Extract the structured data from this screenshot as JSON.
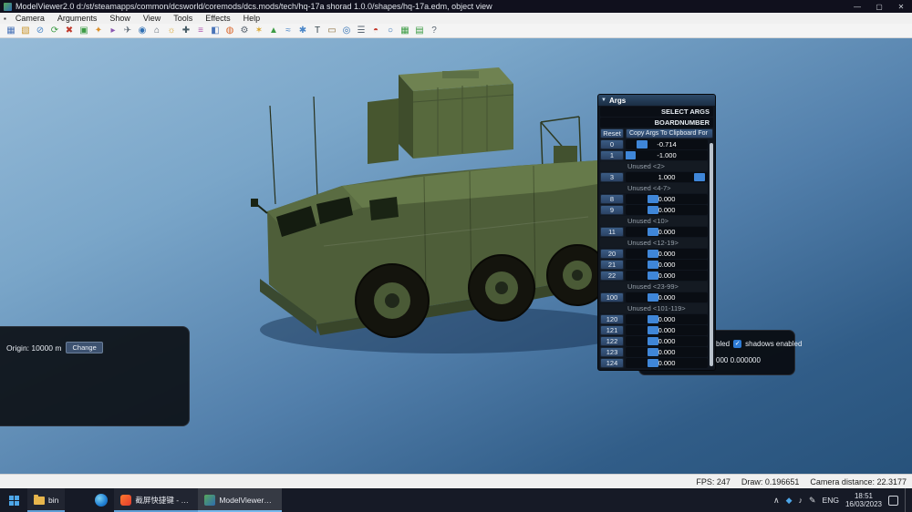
{
  "window": {
    "title": "ModelViewer2.0 d:/st/steamapps/common/dcsworld/coremods/dcs.mods/tech/hq-17a shorad 1.0.0/shapes/hq-17a.edm, object view",
    "controls": {
      "minimize": "—",
      "maximize": "▢",
      "close": "✕"
    }
  },
  "menu": {
    "icon_glyph": "▪",
    "items": [
      "Camera",
      "Arguments",
      "Show",
      "View",
      "Tools",
      "Effects",
      "Help"
    ]
  },
  "toolbar": {
    "icons": [
      {
        "name": "save",
        "glyph": "▦",
        "color": "#4a74b8"
      },
      {
        "name": "open",
        "glyph": "▧",
        "color": "#c9962f"
      },
      {
        "name": "block",
        "glyph": "⊘",
        "color": "#4a86c8"
      },
      {
        "name": "refresh",
        "glyph": "⟳",
        "color": "#3d9c45"
      },
      {
        "name": "clear",
        "glyph": "✖",
        "color": "#c0392b"
      },
      {
        "name": "package",
        "glyph": "▣",
        "color": "#3d9c45"
      },
      {
        "name": "star",
        "glyph": "✦",
        "color": "#d98f2b"
      },
      {
        "name": "pin",
        "glyph": "▸",
        "color": "#8a56b0"
      },
      {
        "name": "plane",
        "glyph": "✈",
        "color": "#5a6672"
      },
      {
        "name": "camera",
        "glyph": "◉",
        "color": "#2f6fb3"
      },
      {
        "name": "home",
        "glyph": "⌂",
        "color": "#5a6672"
      },
      {
        "name": "light",
        "glyph": "☼",
        "color": "#d9a42b"
      },
      {
        "name": "axes",
        "glyph": "✚",
        "color": "#455a64"
      },
      {
        "name": "chart",
        "glyph": "≡",
        "color": "#b05ab0"
      },
      {
        "name": "cube",
        "glyph": "◧",
        "color": "#4a74b8"
      },
      {
        "name": "paint",
        "glyph": "◍",
        "color": "#d9662b"
      },
      {
        "name": "gear",
        "glyph": "⚙",
        "color": "#5a6672"
      },
      {
        "name": "bulb",
        "glyph": "✶",
        "color": "#d9a42b"
      },
      {
        "name": "tree",
        "glyph": "▲",
        "color": "#3d9c45"
      },
      {
        "name": "water",
        "glyph": "≈",
        "color": "#4a86c8"
      },
      {
        "name": "snow",
        "glyph": "✱",
        "color": "#4a86c8"
      },
      {
        "name": "text",
        "glyph": "T",
        "color": "#37474f"
      },
      {
        "name": "ruler",
        "glyph": "▭",
        "color": "#8a6d3b"
      },
      {
        "name": "eye",
        "glyph": "◎",
        "color": "#2f6fb3"
      },
      {
        "name": "layers",
        "glyph": "☰",
        "color": "#5a6672"
      },
      {
        "name": "magnet",
        "glyph": "◓",
        "color": "#c43a2e"
      },
      {
        "name": "search",
        "glyph": "○",
        "color": "#2f6fb3"
      },
      {
        "name": "grid",
        "glyph": "▦",
        "color": "#3d9c45"
      },
      {
        "name": "table",
        "glyph": "▤",
        "color": "#3d9c45"
      },
      {
        "name": "help",
        "glyph": "?",
        "color": "#5a6672"
      }
    ]
  },
  "args_panel": {
    "caret": "▼",
    "title": "Args",
    "select_args_label": "SELECT ARGS",
    "boardnumber_label": "BOARDNUMBER",
    "reset_label": "Reset",
    "copy_label": "Copy Args To Clipboard For",
    "rows": [
      {
        "type": "arg",
        "index": "0",
        "value": "-0.714",
        "pos": 20
      },
      {
        "type": "arg",
        "index": "1",
        "value": "-1.000",
        "pos": 6
      },
      {
        "type": "label",
        "text": "Unused <2>"
      },
      {
        "type": "arg",
        "index": "3",
        "value": "1.000",
        "pos": 90
      },
      {
        "type": "label",
        "text": "Unused <4-7>"
      },
      {
        "type": "arg",
        "index": "8",
        "value": "0.000",
        "pos": 33
      },
      {
        "type": "arg",
        "index": "9",
        "value": "0.000",
        "pos": 33
      },
      {
        "type": "label",
        "text": "Unused <10>"
      },
      {
        "type": "arg",
        "index": "11",
        "value": "0.000",
        "pos": 33
      },
      {
        "type": "label",
        "text": "Unused <12-19>"
      },
      {
        "type": "arg",
        "index": "20",
        "value": "0.000",
        "pos": 33
      },
      {
        "type": "arg",
        "index": "21",
        "value": "0.000",
        "pos": 33
      },
      {
        "type": "arg",
        "index": "22",
        "value": "0.000",
        "pos": 33
      },
      {
        "type": "label",
        "text": "Unused <23-99>"
      },
      {
        "type": "arg",
        "index": "100",
        "value": "0.000",
        "pos": 33
      },
      {
        "type": "label",
        "text": "Unused <101-119>"
      },
      {
        "type": "arg",
        "index": "120",
        "value": "0.000",
        "pos": 33
      },
      {
        "type": "arg",
        "index": "121",
        "value": "0.000",
        "pos": 33
      },
      {
        "type": "arg",
        "index": "122",
        "value": "0.000",
        "pos": 33
      },
      {
        "type": "arg",
        "index": "123",
        "value": "0.000",
        "pos": 33
      },
      {
        "type": "arg",
        "index": "124",
        "value": "0.000",
        "pos": 33
      }
    ]
  },
  "origin_panel": {
    "label": "Origin: 10000 m",
    "button_label": "Change"
  },
  "render_panel": {
    "clipped_fragment": "bled",
    "check": "✓",
    "shadows_label": "shadows enabled",
    "values_fragment": "000 0.000000"
  },
  "status_bar": {
    "fps": "FPS: 247",
    "draw": "Draw: 0.196651",
    "camera": "Camera distance: 22.3177"
  },
  "taskbar": {
    "apps": [
      {
        "kind": "explorer",
        "label": "bin",
        "state": "open"
      },
      {
        "kind": "browser",
        "label": "",
        "state": ""
      },
      {
        "kind": "sogou",
        "label": "截屏快捷键 - 搜狗...",
        "state": "open"
      },
      {
        "kind": "modelviewer",
        "label": "ModelViewer2.0 ...",
        "state": "active"
      }
    ],
    "tray_icons": [
      {
        "name": "hidden-icons-chevron-icon",
        "glyph": "∧"
      },
      {
        "name": "bluetooth-icon",
        "glyph": "◆",
        "color": "#4da6e8"
      },
      {
        "name": "volume-icon",
        "glyph": "♪"
      },
      {
        "name": "pen-icon",
        "glyph": "✎"
      }
    ],
    "language": "ENG",
    "time": "18:51",
    "date": "16/03/2023"
  }
}
